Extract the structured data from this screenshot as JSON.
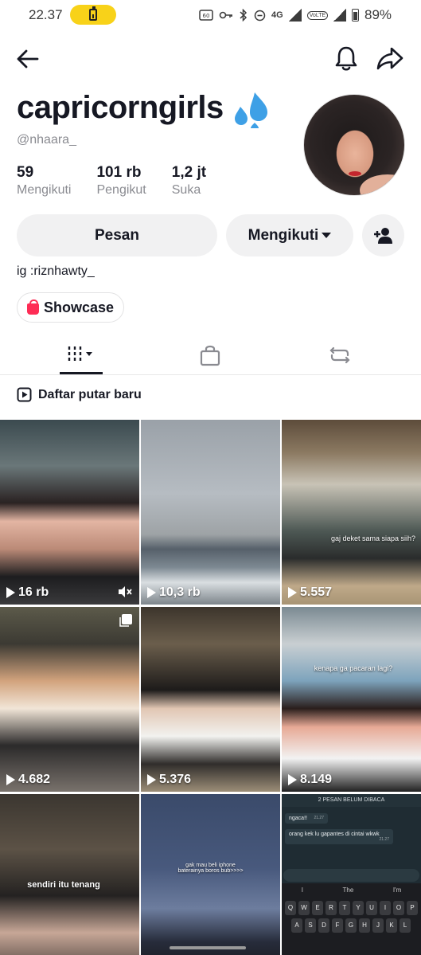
{
  "status_bar": {
    "time": "22.37",
    "battery_percent": "89%",
    "icons": [
      "battery-charging-icon",
      "hd-icon",
      "key-icon",
      "bluetooth-icon",
      "dnd-icon",
      "4g-icon",
      "signal-icon",
      "volte-icon",
      "signal-icon",
      "battery-icon"
    ],
    "network_label": "4G",
    "sim1": "1",
    "volte_label": "VoLTE",
    "sim2": "2"
  },
  "profile": {
    "display_name": "capricorngirls",
    "handle": "@nhaara_",
    "stats": [
      {
        "value": "59",
        "label": "Mengikuti"
      },
      {
        "value": "101 rb",
        "label": "Pengikut"
      },
      {
        "value": "1,2 jt",
        "label": "Suka"
      }
    ],
    "bio": "ig :riznhawty_"
  },
  "actions": {
    "message_label": "Pesan",
    "following_label": "Mengikuti",
    "showcase_label": "Showcase"
  },
  "playlist": {
    "label": "Daftar putar baru"
  },
  "videos": [
    {
      "views": "16 rb",
      "caption": ""
    },
    {
      "views": "10,3 rb",
      "caption": ""
    },
    {
      "views": "5.557",
      "caption": "gaj deket sama siapa siih?"
    },
    {
      "views": "4.682",
      "caption": ""
    },
    {
      "views": "5.376",
      "caption": ""
    },
    {
      "views": "8.149",
      "caption": "kenapa ga pacaran lagi?"
    },
    {
      "views": "",
      "caption": "sendiri itu tenang"
    },
    {
      "views": "",
      "caption": "gak mau beli iphone baterainya boros bub>>>>"
    },
    {
      "views": "",
      "caption": ""
    }
  ],
  "chat_preview": {
    "header": "2 PESAN BELUM DIBACA",
    "messages": [
      {
        "text": "ngaca!!",
        "time": "21.27"
      },
      {
        "text": "orang kek lu gapantes di cintai wkwk",
        "time": "21.27"
      }
    ],
    "suggestions": [
      "I",
      "The",
      "I'm"
    ],
    "row1": [
      "Q",
      "W",
      "E",
      "R",
      "T",
      "Y",
      "U",
      "I",
      "O",
      "P"
    ],
    "row2": [
      "A",
      "S",
      "D",
      "F",
      "G",
      "H",
      "J",
      "K",
      "L"
    ]
  },
  "colors": {
    "text_primary": "#161823",
    "text_secondary": "#8a8b91",
    "button_bg": "#f1f1f2",
    "accent": "#fe2c55",
    "battery_pill": "#f8d219"
  }
}
